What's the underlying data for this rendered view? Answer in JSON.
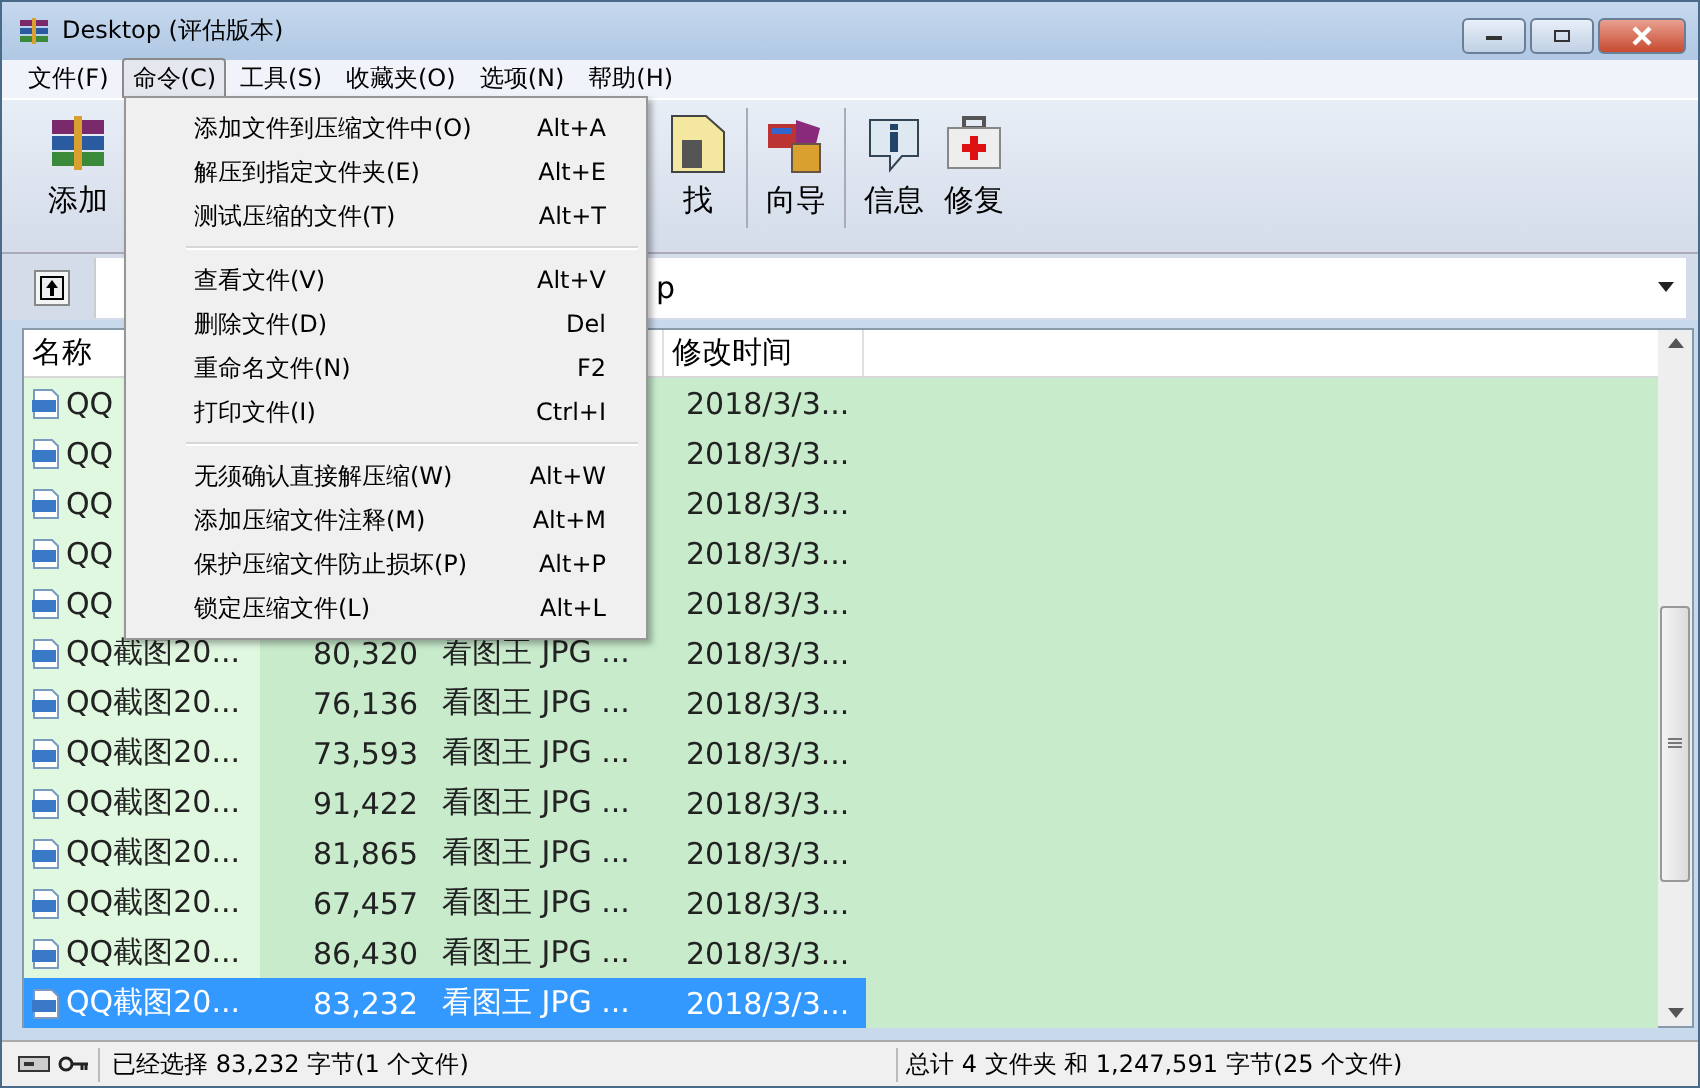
{
  "window": {
    "title": "Desktop (评估版本)"
  },
  "menu_bar": [
    {
      "label": "文件(F)",
      "selected": false
    },
    {
      "label": "命令(C)",
      "selected": true
    },
    {
      "label": "工具(S)",
      "selected": false
    },
    {
      "label": "收藏夹(O)",
      "selected": false
    },
    {
      "label": "选项(N)",
      "selected": false
    },
    {
      "label": "帮助(H)",
      "selected": false
    }
  ],
  "toolbar": [
    {
      "kind": "archive",
      "label": "添加"
    },
    {
      "kind": "find",
      "label": "找"
    },
    {
      "kind": "wizard",
      "label": "向导"
    },
    {
      "kind": "info",
      "label": "信息"
    },
    {
      "kind": "repair",
      "label": "修复"
    }
  ],
  "address": {
    "value": "p"
  },
  "columns": [
    {
      "kind": "name",
      "label": "名称"
    },
    {
      "kind": "date",
      "label": "修改时间"
    }
  ],
  "rows": [
    {
      "name": "QQ",
      "date": "2018/3/3...",
      "selected": false
    },
    {
      "name": "QQ",
      "date": "2018/3/3...",
      "selected": false
    },
    {
      "name": "QQ",
      "date": "2018/3/3...",
      "selected": false
    },
    {
      "name": "QQ",
      "date": "2018/3/3...",
      "selected": false
    },
    {
      "name": "QQ",
      "date": "2018/3/3...",
      "selected": false
    },
    {
      "name": "QQ截图20...",
      "size": "80,320",
      "type": "看图王 JPG ...",
      "date": "2018/3/3...",
      "selected": false
    },
    {
      "name": "QQ截图20...",
      "size": "76,136",
      "type": "看图王 JPG ...",
      "date": "2018/3/3...",
      "selected": false
    },
    {
      "name": "QQ截图20...",
      "size": "73,593",
      "type": "看图王 JPG ...",
      "date": "2018/3/3...",
      "selected": false
    },
    {
      "name": "QQ截图20...",
      "size": "91,422",
      "type": "看图王 JPG ...",
      "date": "2018/3/3...",
      "selected": false
    },
    {
      "name": "QQ截图20...",
      "size": "81,865",
      "type": "看图王 JPG ...",
      "date": "2018/3/3...",
      "selected": false
    },
    {
      "name": "QQ截图20...",
      "size": "67,457",
      "type": "看图王 JPG ...",
      "date": "2018/3/3...",
      "selected": false
    },
    {
      "name": "QQ截图20...",
      "size": "86,430",
      "type": "看图王 JPG ...",
      "date": "2018/3/3...",
      "selected": false
    },
    {
      "name": "QQ截图20...",
      "size": "83,232",
      "type": "看图王 JPG ...",
      "date": "2018/3/3...",
      "selected": true
    }
  ],
  "menu": {
    "items": [
      {
        "kind": "item",
        "label": "添加文件到压缩文件中(O)",
        "shortcut": "Alt+A"
      },
      {
        "kind": "item",
        "label": "解压到指定文件夹(E)",
        "shortcut": "Alt+E"
      },
      {
        "kind": "item",
        "label": "测试压缩的文件(T)",
        "shortcut": "Alt+T"
      },
      {
        "kind": "separator"
      },
      {
        "kind": "item",
        "label": "查看文件(V)",
        "shortcut": "Alt+V"
      },
      {
        "kind": "item",
        "label": "删除文件(D)",
        "shortcut": "Del"
      },
      {
        "kind": "item",
        "label": "重命名文件(N)",
        "shortcut": "F2"
      },
      {
        "kind": "item",
        "label": "打印文件(I)",
        "shortcut": "Ctrl+I"
      },
      {
        "kind": "separator"
      },
      {
        "kind": "item",
        "label": "无须确认直接解压缩(W)",
        "shortcut": "Alt+W"
      },
      {
        "kind": "item",
        "label": "添加压缩文件注释(M)",
        "shortcut": "Alt+M"
      },
      {
        "kind": "item",
        "label": "保护压缩文件防止损坏(P)",
        "shortcut": "Alt+P"
      },
      {
        "kind": "item",
        "label": "锁定压缩文件(L)",
        "shortcut": "Alt+L"
      }
    ]
  },
  "status_bar": {
    "left": "已经选择 83,232 字节(1 个文件)",
    "right": "总计 4 文件夹 和 1,247,591 字节(25 个文件)"
  }
}
